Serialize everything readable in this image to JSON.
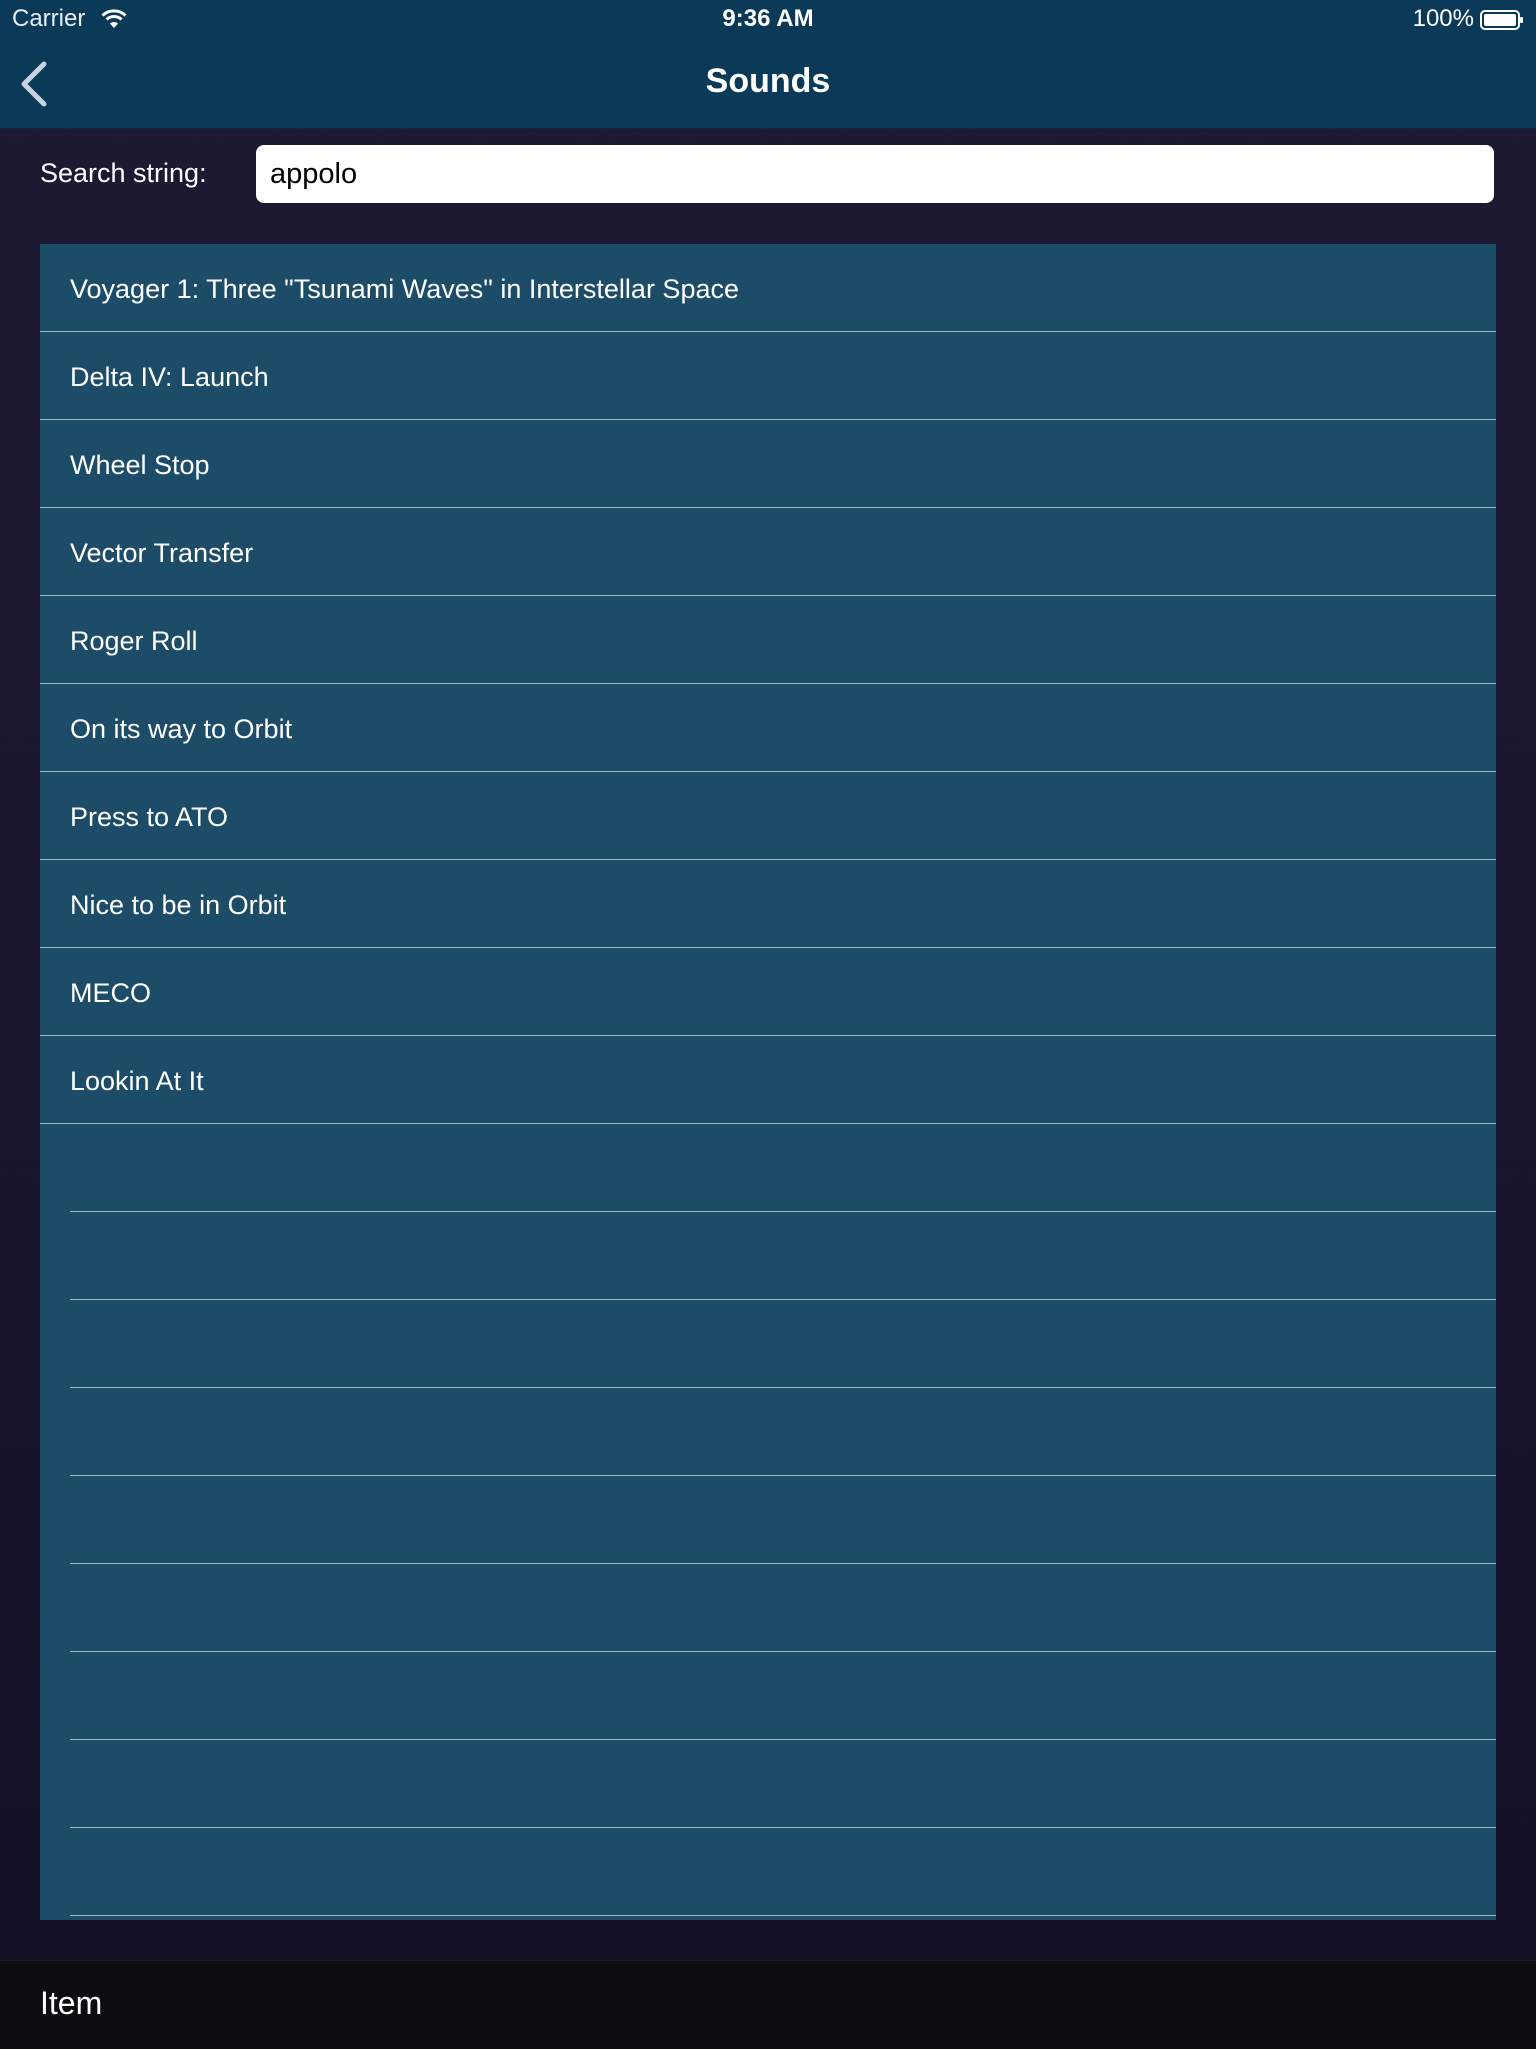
{
  "status_bar": {
    "carrier": "Carrier",
    "time": "9:36 AM",
    "battery": "100%",
    "wifi_icon": "wifi-icon",
    "battery_icon": "battery-full-icon"
  },
  "nav": {
    "title": "Sounds",
    "back_icon": "chevron-left-icon"
  },
  "search": {
    "label": "Search string:",
    "value": "appolo"
  },
  "results": [
    "Voyager 1: Three \"Tsunami Waves\" in Interstellar Space",
    "Delta IV: Launch",
    "Wheel Stop",
    "Vector Transfer",
    "Roger Roll",
    "On its way to Orbit",
    "Press to ATO",
    "Nice to be in Orbit",
    "MECO",
    "Lookin At It"
  ],
  "tab_bar": {
    "item_label": "Item"
  },
  "colors": {
    "nav_background": "#0a3a58",
    "table_background": "#1d4c68",
    "page_background": "#1a1630",
    "tab_bar_background": "#0d0d10"
  }
}
